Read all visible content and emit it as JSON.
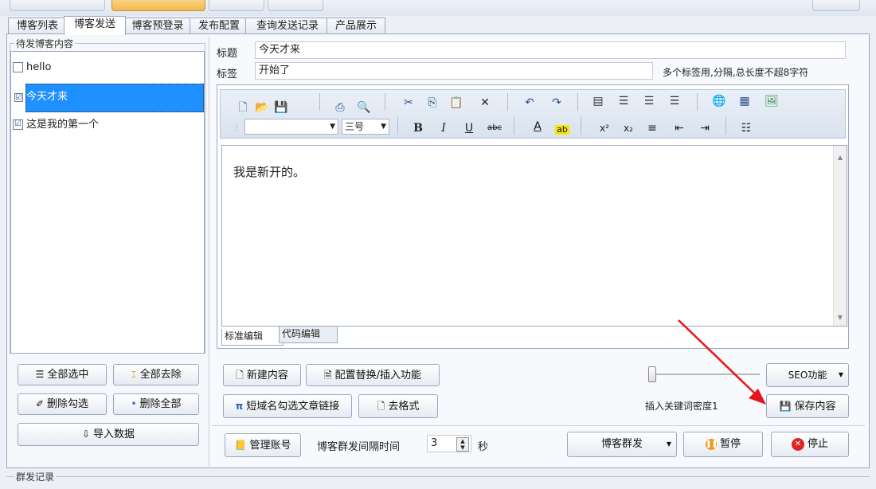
{
  "tabs": [
    {
      "label": "博客列表"
    },
    {
      "label": "博客发送"
    },
    {
      "label": "博客预登录"
    },
    {
      "label": "发布配置"
    },
    {
      "label": "查询发送记录"
    },
    {
      "label": "产品展示"
    }
  ],
  "left": {
    "group_title": "待发博客内容",
    "items": [
      {
        "label": "hello",
        "checked": false
      },
      {
        "label": "今天才来",
        "checked": true
      },
      {
        "label": "这是我的第一个",
        "checked": true
      }
    ],
    "check_mark": "☑",
    "buttons": {
      "select_all": "全部选中",
      "deselect_all": "全部去除",
      "delete_checked": "删除勾选",
      "delete_all": "删除全部",
      "import": "导入数据"
    }
  },
  "form": {
    "title_label": "标题",
    "title_value": "今天才来",
    "tags_label": "标签",
    "tags_value": "开始了",
    "tags_hint": "多个标签用,分隔,总长度不超8字符"
  },
  "editor": {
    "font_size": "三号",
    "content": "我是新开的。",
    "tab_standard": "标准编辑",
    "tab_code": "代码编辑"
  },
  "actions": {
    "new_content": "新建内容",
    "config_replace": "配置替换/插入功能",
    "short_domain": "短域名勾选文章链接",
    "clear_format": "去格式",
    "seo": "SEO功能",
    "keyword_density": "插入关键词密度1",
    "save_content": "保存内容"
  },
  "footer": {
    "manage_accounts": "管理账号",
    "interval_label": "博客群发间隔时间",
    "interval_value": "3",
    "seconds": "秒",
    "mass_send": "博客群发",
    "pause": "暂停",
    "stop": "停止"
  },
  "log_title": "群发记录",
  "colors": {
    "selection": "#1e90ff",
    "arrow": "#e8141b",
    "pause_icon": "#f39a1d",
    "stop_icon": "#e02424"
  }
}
